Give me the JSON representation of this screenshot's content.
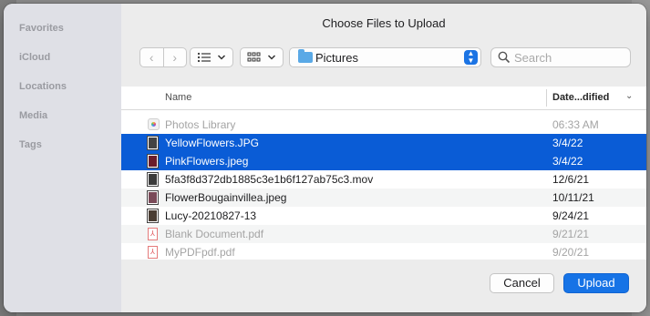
{
  "dialog": {
    "title": "Choose Files to Upload"
  },
  "sidebar": {
    "sections": [
      "Favorites",
      "iCloud",
      "Locations",
      "Media",
      "Tags"
    ]
  },
  "toolbar": {
    "back_glyph": "‹",
    "forward_glyph": "›",
    "list_view_icon": "list-icon",
    "grid_view_icon": "grid-icon",
    "location": "Pictures",
    "search_placeholder": "Search"
  },
  "table": {
    "columns": {
      "name": "Name",
      "date": "Date...dified"
    },
    "rows": [
      {
        "name": "Photos Library",
        "date": "06:33 AM",
        "icon": "photos-library-icon",
        "state": "disabled"
      },
      {
        "name": "YellowFlowers.JPG",
        "date": "3/4/22",
        "icon": "image-thumbnail-icon",
        "state": "selected"
      },
      {
        "name": "PinkFlowers.jpeg",
        "date": "3/4/22",
        "icon": "image-thumbnail-icon",
        "state": "selected"
      },
      {
        "name": "5fa3f8d372db1885c3e1b6f127ab75c3.mov",
        "date": "12/6/21",
        "icon": "movie-thumbnail-icon",
        "state": "normal"
      },
      {
        "name": "FlowerBougainvillea.jpeg",
        "date": "10/11/21",
        "icon": "image-thumbnail-icon",
        "state": "normal"
      },
      {
        "name": "Lucy-20210827-13",
        "date": "9/24/21",
        "icon": "image-thumbnail-icon",
        "state": "normal"
      },
      {
        "name": "Blank Document.pdf",
        "date": "9/21/21",
        "icon": "pdf-icon",
        "state": "disabled"
      },
      {
        "name": "MyPDFpdf.pdf",
        "date": "9/20/21",
        "icon": "pdf-icon",
        "state": "disabled"
      }
    ]
  },
  "footer": {
    "cancel_label": "Cancel",
    "upload_label": "Upload"
  },
  "colors": {
    "accent": "#1673e6",
    "selection": "#0a5cd6",
    "sidebar_bg": "#dfe0e6"
  }
}
